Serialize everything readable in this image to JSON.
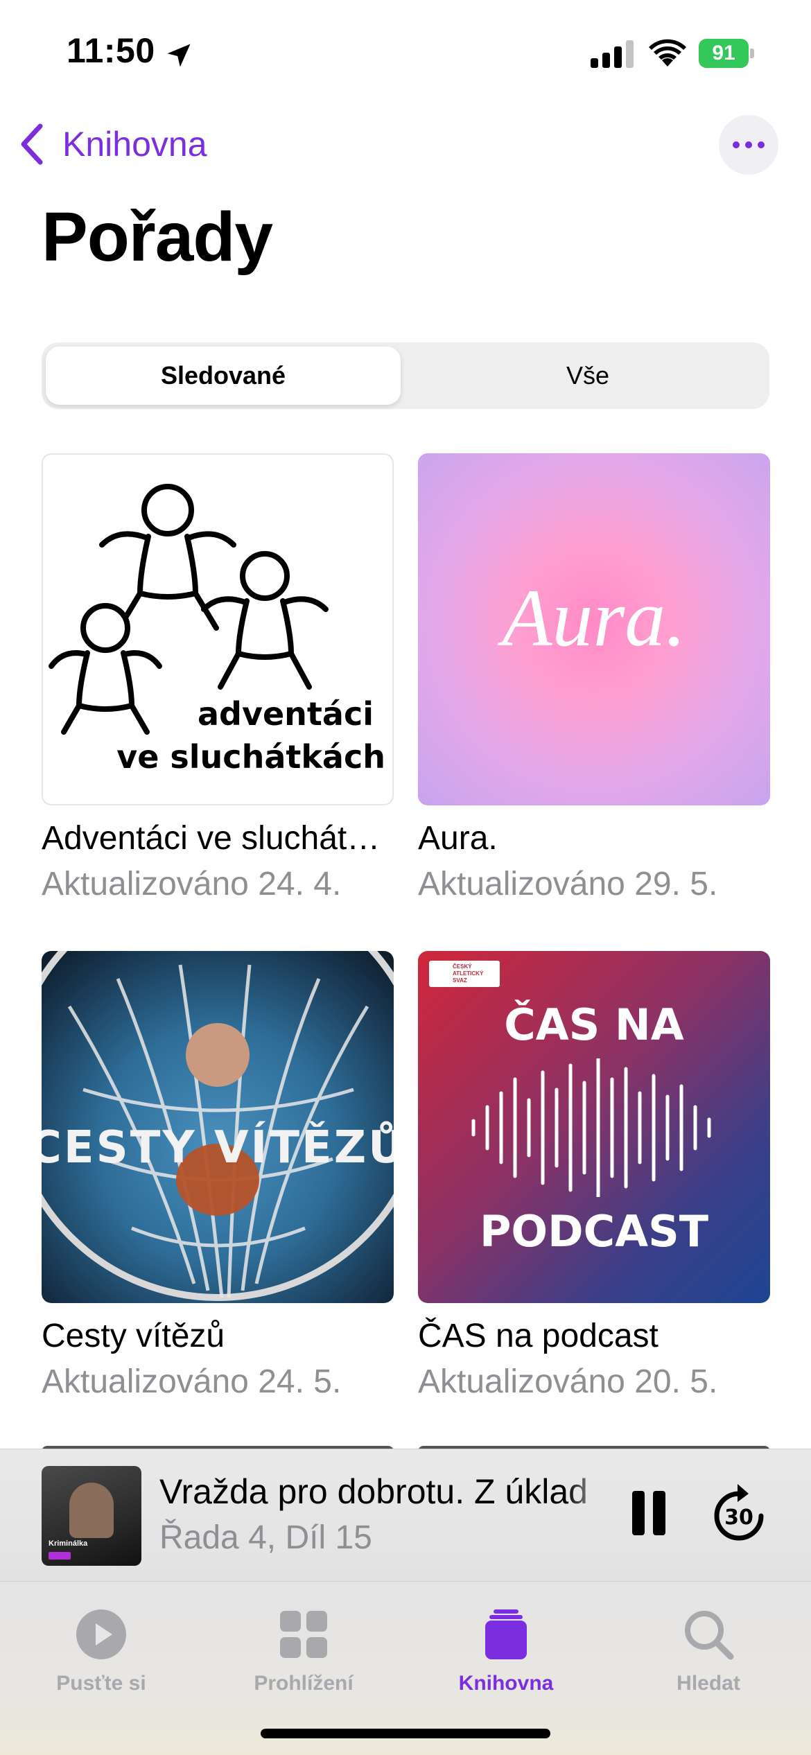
{
  "status_bar": {
    "time": "11:50",
    "battery": "91"
  },
  "nav": {
    "back_label": "Knihovna",
    "more_label": "Více"
  },
  "page": {
    "title": "Pořady"
  },
  "segments": {
    "followed": "Sledované",
    "all": "Vše"
  },
  "shows": [
    {
      "title": "Adventáci ve sluchátkách",
      "subtitle": "Aktualizováno 24. 4.",
      "art_text": [
        "adventáci",
        "ve sluchátkách"
      ]
    },
    {
      "title": "Aura.",
      "subtitle": "Aktualizováno 29. 5.",
      "art_text": [
        "Aura."
      ]
    },
    {
      "title": "Cesty vítězů",
      "subtitle": "Aktualizováno 24. 5.",
      "art_text": [
        "CESTY VÍTĚZŮ"
      ]
    },
    {
      "title": "ČAS na podcast",
      "subtitle": "Aktualizováno 20. 5.",
      "art_text": [
        "ČAS NA",
        "PODCAST"
      ],
      "logo_text": "ČESKÝ ATLETICKÝ SVAZ"
    }
  ],
  "player": {
    "title": "Vražda pro dobrotu. Z úklad",
    "subtitle": "Řada 4, Díl 15",
    "art_label": "Kriminálka",
    "skip_seconds": "30"
  },
  "tabs": [
    {
      "label": "Pusťte si",
      "icon": "play-circle-icon"
    },
    {
      "label": "Prohlížení",
      "icon": "grid-icon"
    },
    {
      "label": "Knihovna",
      "icon": "library-icon"
    },
    {
      "label": "Hledat",
      "icon": "search-icon"
    }
  ],
  "colors": {
    "accent": "#7b2ee0",
    "secondary_text": "#8e8e93",
    "battery": "#34c759"
  }
}
